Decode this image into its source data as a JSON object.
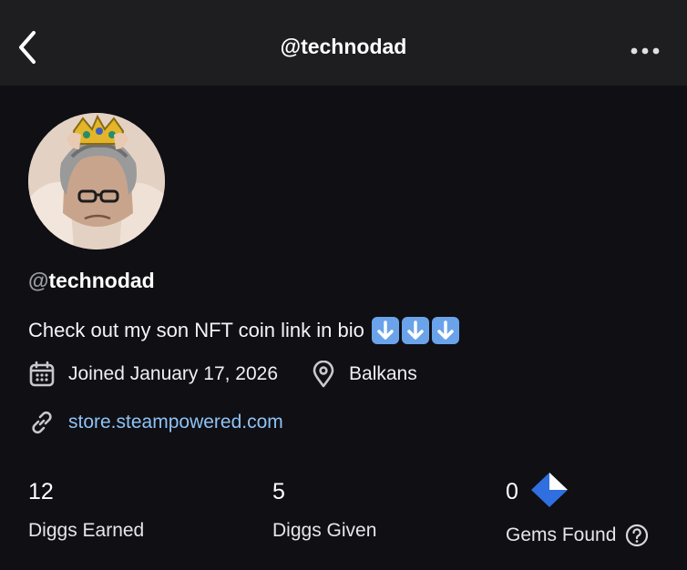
{
  "header": {
    "title": "@technodad",
    "back_icon": "chevron-left-icon",
    "more_icon": "ellipsis-icon"
  },
  "profile": {
    "avatar_icon": "avatar-image",
    "handle_at": "@",
    "handle_name": "technodad",
    "bio_text": "Check out my son NFT coin link in bio",
    "bio_emojis": [
      "down-arrow-emoji",
      "down-arrow-emoji",
      "down-arrow-emoji"
    ],
    "joined": "Joined January 17, 2026",
    "location": "Balkans",
    "link": "store.steampowered.com"
  },
  "stats": [
    {
      "value": "12",
      "label": "Diggs Earned"
    },
    {
      "value": "5",
      "label": "Diggs Given"
    },
    {
      "value": "0",
      "label": "Gems Found"
    }
  ],
  "colors": {
    "background": "#0f0f14",
    "topbar": "#1e1e20",
    "link": "#8ec3f5",
    "gem": "#2f6fe0"
  }
}
